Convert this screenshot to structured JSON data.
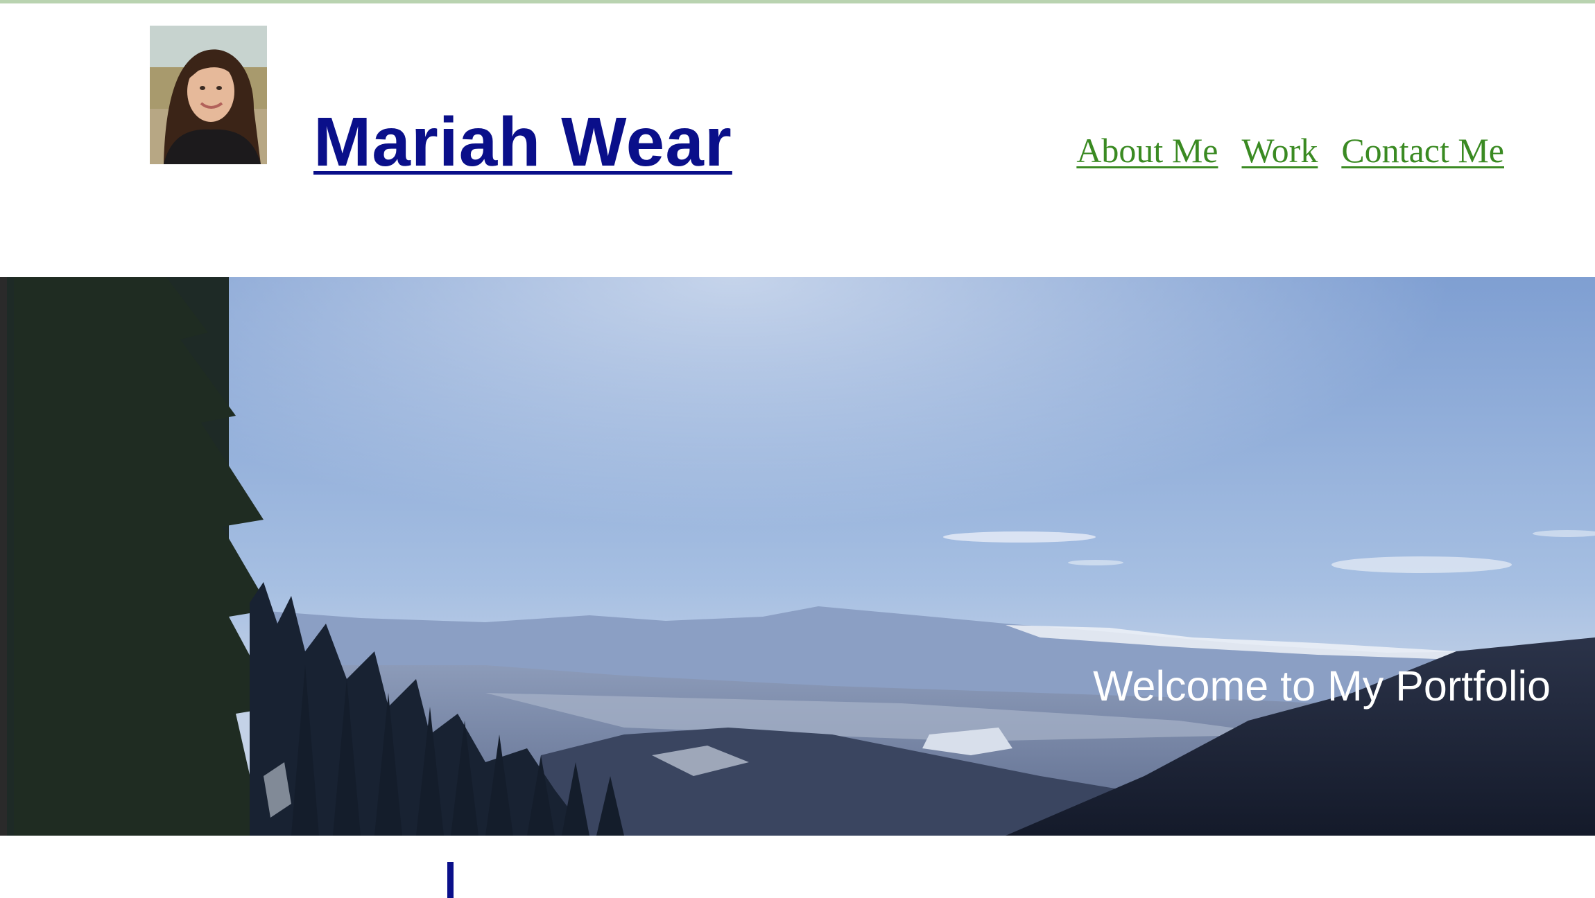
{
  "header": {
    "title": "Mariah Wear",
    "avatar_alt": "Photo of Mariah Wear"
  },
  "nav": {
    "items": [
      {
        "label": "About Me"
      },
      {
        "label": "Work"
      },
      {
        "label": "Contact Me"
      }
    ]
  },
  "hero": {
    "caption": "Welcome to My Portfolio"
  },
  "colors": {
    "title": "#0a0f8a",
    "nav_link": "#3a8a22",
    "top_rule": "#b9d3b0",
    "caption": "#ffffff"
  }
}
